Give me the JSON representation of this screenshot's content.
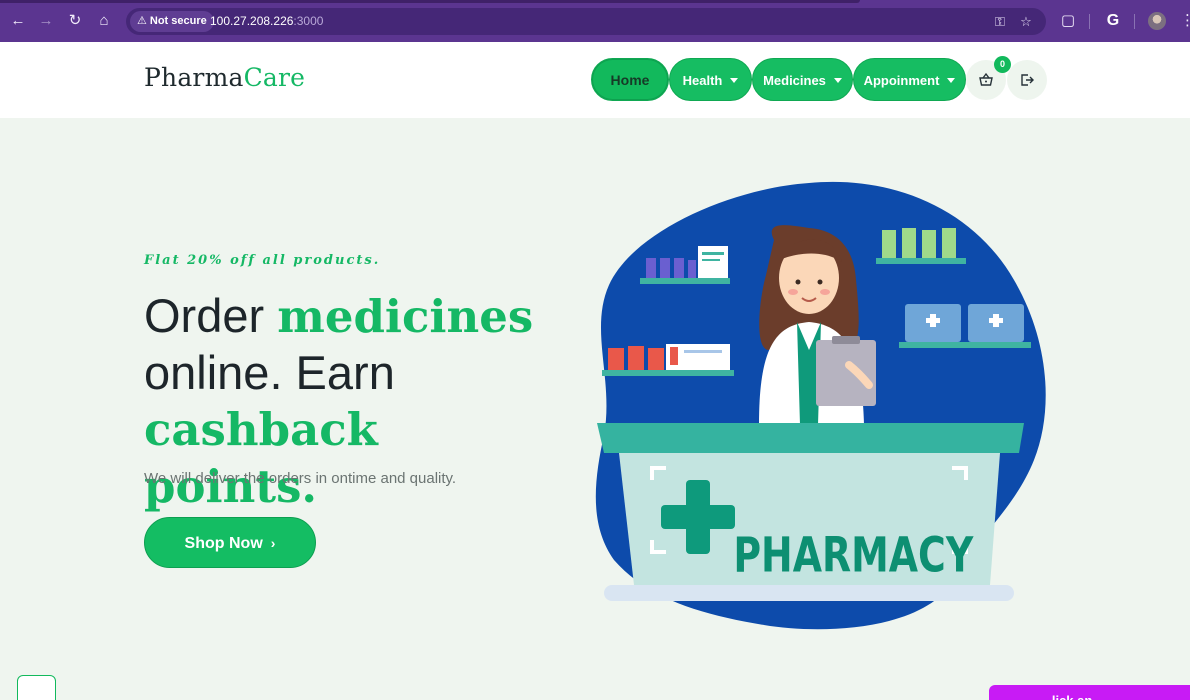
{
  "browser": {
    "security_label": "Not secure",
    "url_host": "100.27.208.226",
    "url_port": ":3000",
    "profile_initial": "G"
  },
  "site": {
    "logo_main": "Pharma",
    "logo_accent": "Care",
    "nav": {
      "home": "Home",
      "health": "Health",
      "medicines": "Medicines",
      "appointment": "Appoinment"
    },
    "cart_count": "0"
  },
  "hero": {
    "tagline": "Flat 20% off all products.",
    "headline_1": "Order ",
    "headline_2": "medicines",
    "headline_3": "online. Earn",
    "headline_4": "cashback points.",
    "subtext": "We will deliver the orders in ontime and quality.",
    "cta": "Shop Now",
    "art_sign": "PHARMACY"
  },
  "chat_widget_text": "...lick an..."
}
